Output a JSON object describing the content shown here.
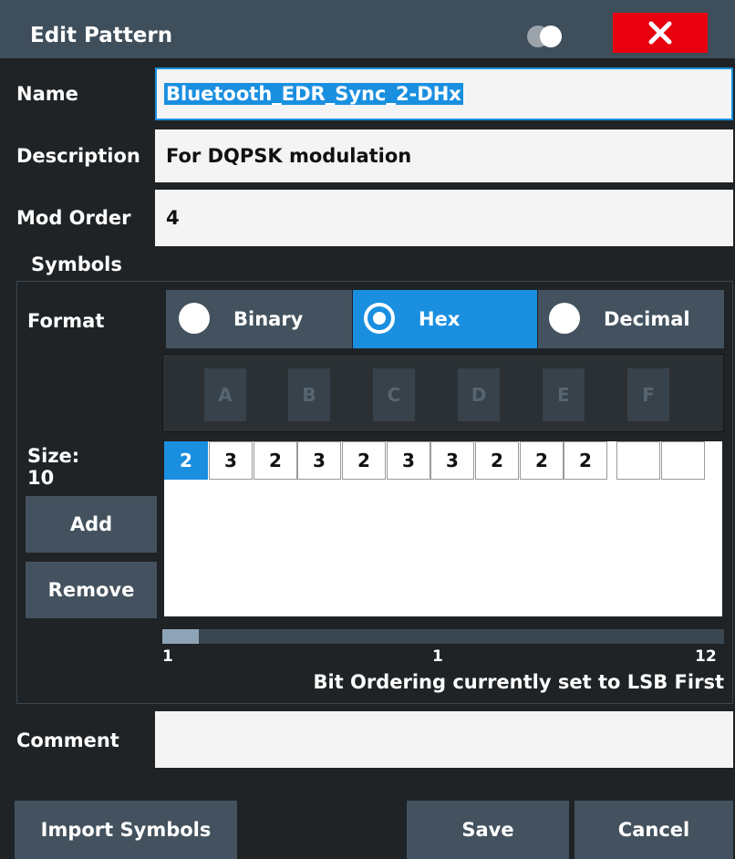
{
  "dialog": {
    "title": "Edit Pattern",
    "close_icon": "close-x-icon",
    "toggle_icon": "theme-toggle-icon",
    "accent_color": "#1a8fe0",
    "close_color": "#e8000f"
  },
  "fields": {
    "name_label": "Name",
    "name_value": "Bluetooth_EDR_Sync_2-DHx",
    "description_label": "Description",
    "description_value": "For DQPSK modulation",
    "mod_order_label": "Mod Order",
    "mod_order_value": "4",
    "comment_label": "Comment",
    "comment_value": ""
  },
  "symbols": {
    "section_label": "Symbols",
    "format_label": "Format",
    "format_options": [
      {
        "label": "Binary",
        "selected": false
      },
      {
        "label": "Hex",
        "selected": true
      },
      {
        "label": "Decimal",
        "selected": false
      }
    ],
    "hex_keys": [
      "A",
      "B",
      "C",
      "D",
      "E",
      "F"
    ],
    "size_label": "Size:",
    "size_value": "10",
    "values": [
      "2",
      "3",
      "2",
      "3",
      "2",
      "3",
      "3",
      "2",
      "2",
      "2",
      "",
      ""
    ],
    "add_label": "Add",
    "remove_label": "Remove",
    "scroll_left": "1",
    "scroll_mid": "1",
    "scroll_right": "12",
    "bit_ordering_text": "Bit Ordering currently set to LSB First"
  },
  "footer": {
    "import_label": "Import Symbols",
    "save_label": "Save",
    "cancel_label": "Cancel"
  }
}
